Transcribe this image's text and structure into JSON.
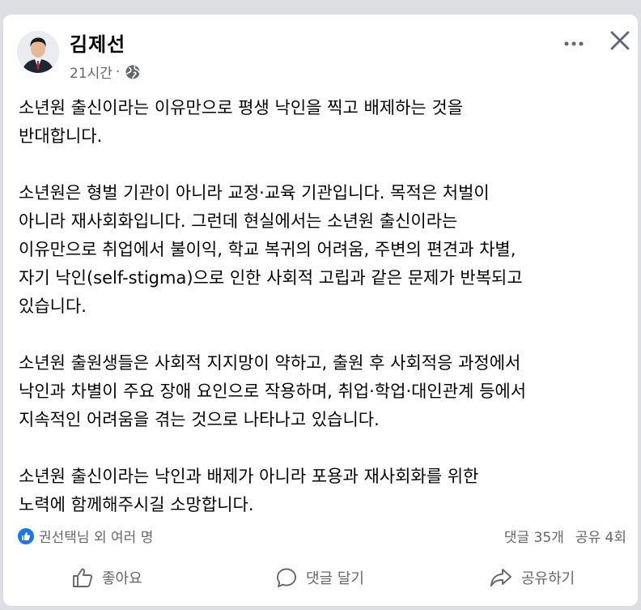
{
  "post": {
    "author": "김제선",
    "time": "21시간",
    "separator": "·",
    "paragraphs": [
      [
        "소년원 출신이라는 이유만으로 평생 낙인을 찍고 배제하는 것을",
        "반대합니다."
      ],
      [
        "소년원은 형벌 기관이 아니라 교정·교육 기관입니다. 목적은 처벌이",
        "아니라 재사회화입니다. 그런데 현실에서는 소년원 출신이라는",
        "이유만으로 취업에서 불이익, 학교 복귀의 어려움, 주변의 편견과 차별,",
        "자기 낙인(self-stigma)으로 인한 사회적 고립과 같은 문제가 반복되고",
        "있습니다."
      ],
      [
        "소년원 출원생들은 사회적 지지망이 약하고, 출원 후 사회적응 과정에서",
        "낙인과 차별이 주요 장애 요인으로 작용하며, 취업·학업·대인관계 등에서",
        "지속적인 어려움을 겪는 것으로 나타나고 있습니다."
      ],
      [
        "소년원 출신이라는 낙인과 배제가 아니라 포용과 재사회화를 위한",
        "노력에 함께해주시길 소망합니다."
      ]
    ]
  },
  "reactions": {
    "summary": "권선택님 외 여러 명",
    "comments": "댓글 35개",
    "shares": "공유 4회"
  },
  "actions": {
    "like": "좋아요",
    "comment": "댓글 달기",
    "share": "공유하기"
  },
  "icons": {
    "more": "more-horizontal-icon",
    "close": "close-icon",
    "privacy": "globe-icon",
    "reaction": "thumbs-up-icon",
    "like": "thumbs-up-outline-icon",
    "comment": "speech-bubble-icon",
    "share": "share-arrow-icon"
  },
  "colors": {
    "accent": "#1877f2",
    "text": "#050505",
    "secondary": "#65676b"
  }
}
